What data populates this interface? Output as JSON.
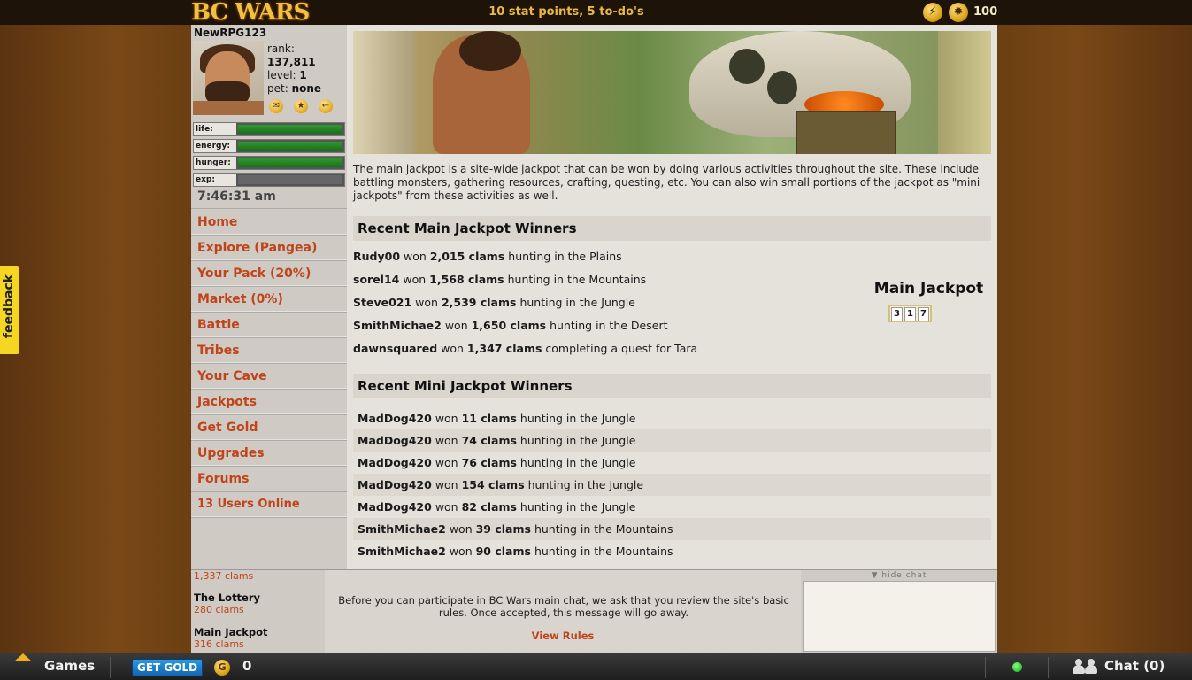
{
  "header": {
    "logo": "BC WARS",
    "status": "10 stat points, 5 to-do's",
    "gold_amount": "100"
  },
  "profile": {
    "username": "NewRPG123",
    "rank_label": "rank:",
    "rank_value": "137,811",
    "level_label": "level:",
    "level_value": "1",
    "pet_label": "pet:",
    "pet_value": "none"
  },
  "bars": [
    {
      "label": "life:",
      "fill": 1.0
    },
    {
      "label": "energy:",
      "fill": 1.0
    },
    {
      "label": "hunger:",
      "fill": 1.0
    },
    {
      "label": "exp:",
      "fill": 0.0
    }
  ],
  "clock": "7:46:31 am",
  "nav": [
    "Home",
    "Explore (Pangea)",
    "Your Pack (20%)",
    "Market (0%)",
    "Battle",
    "Tribes",
    "Your Cave",
    "Jackpots",
    "Get Gold",
    "Upgrades",
    "Forums",
    "13 Users Online"
  ],
  "feedback_label": "feedback",
  "intro": "The main jackpot is a site-wide jackpot that can be won by doing various activities throughout the site. These include battling monsters, gathering resources, crafting, questing, etc. You can also win small portions of the jackpot as \"mini jackpots\" from these activities as well.",
  "main_winners": {
    "title": "Recent Main Jackpot Winners",
    "rows": [
      {
        "name": "Rudy00",
        "won": "won",
        "amount": "2,015 clams",
        "activity": "hunting in the Plains"
      },
      {
        "name": "sorel14",
        "won": "won",
        "amount": "1,568 clams",
        "activity": "hunting in the Mountains"
      },
      {
        "name": "Steve021",
        "won": "won",
        "amount": "2,539 clams",
        "activity": "hunting in the Jungle"
      },
      {
        "name": "SmithMichae2",
        "won": "won",
        "amount": "1,650 clams",
        "activity": "hunting in the Desert"
      },
      {
        "name": "dawnsquared",
        "won": "won",
        "amount": "1,347 clams",
        "activity": "completing a quest for Tara"
      }
    ]
  },
  "jackpot": {
    "title": "Main Jackpot",
    "digits": [
      "3",
      "1",
      "7"
    ]
  },
  "mini_winners": {
    "title": "Recent Mini Jackpot Winners",
    "rows": [
      {
        "name": "MadDog420",
        "won": "won",
        "amount": "11 clams",
        "activity": "hunting in the Jungle"
      },
      {
        "name": "MadDog420",
        "won": "won",
        "amount": "74 clams",
        "activity": "hunting in the Jungle"
      },
      {
        "name": "MadDog420",
        "won": "won",
        "amount": "76 clams",
        "activity": "hunting in the Jungle"
      },
      {
        "name": "MadDog420",
        "won": "won",
        "amount": "154 clams",
        "activity": "hunting in the Jungle"
      },
      {
        "name": "MadDog420",
        "won": "won",
        "amount": "82 clams",
        "activity": "hunting in the Jungle"
      },
      {
        "name": "SmithMichae2",
        "won": "won",
        "amount": "39 clams",
        "activity": "hunting in the Mountains"
      },
      {
        "name": "SmithMichae2",
        "won": "won",
        "amount": "90 clams",
        "activity": "hunting in the Mountains"
      }
    ]
  },
  "bottom_left": {
    "top_amount": "1,337 clams",
    "lottery_label": "The Lottery",
    "lottery_amount": "280 clams",
    "jackpot_label": "Main Jackpot",
    "jackpot_amount": "316 clams"
  },
  "chat_notice": {
    "message": "Before you can participate in BC Wars main chat, we ask that you review the site's basic rules. Once accepted, this message will go away.",
    "link": "View Rules",
    "hide": "hide chat"
  },
  "bottombar": {
    "games": "Games",
    "get_gold": "GET GOLD",
    "gold": "0",
    "chat": "Chat (0)"
  }
}
